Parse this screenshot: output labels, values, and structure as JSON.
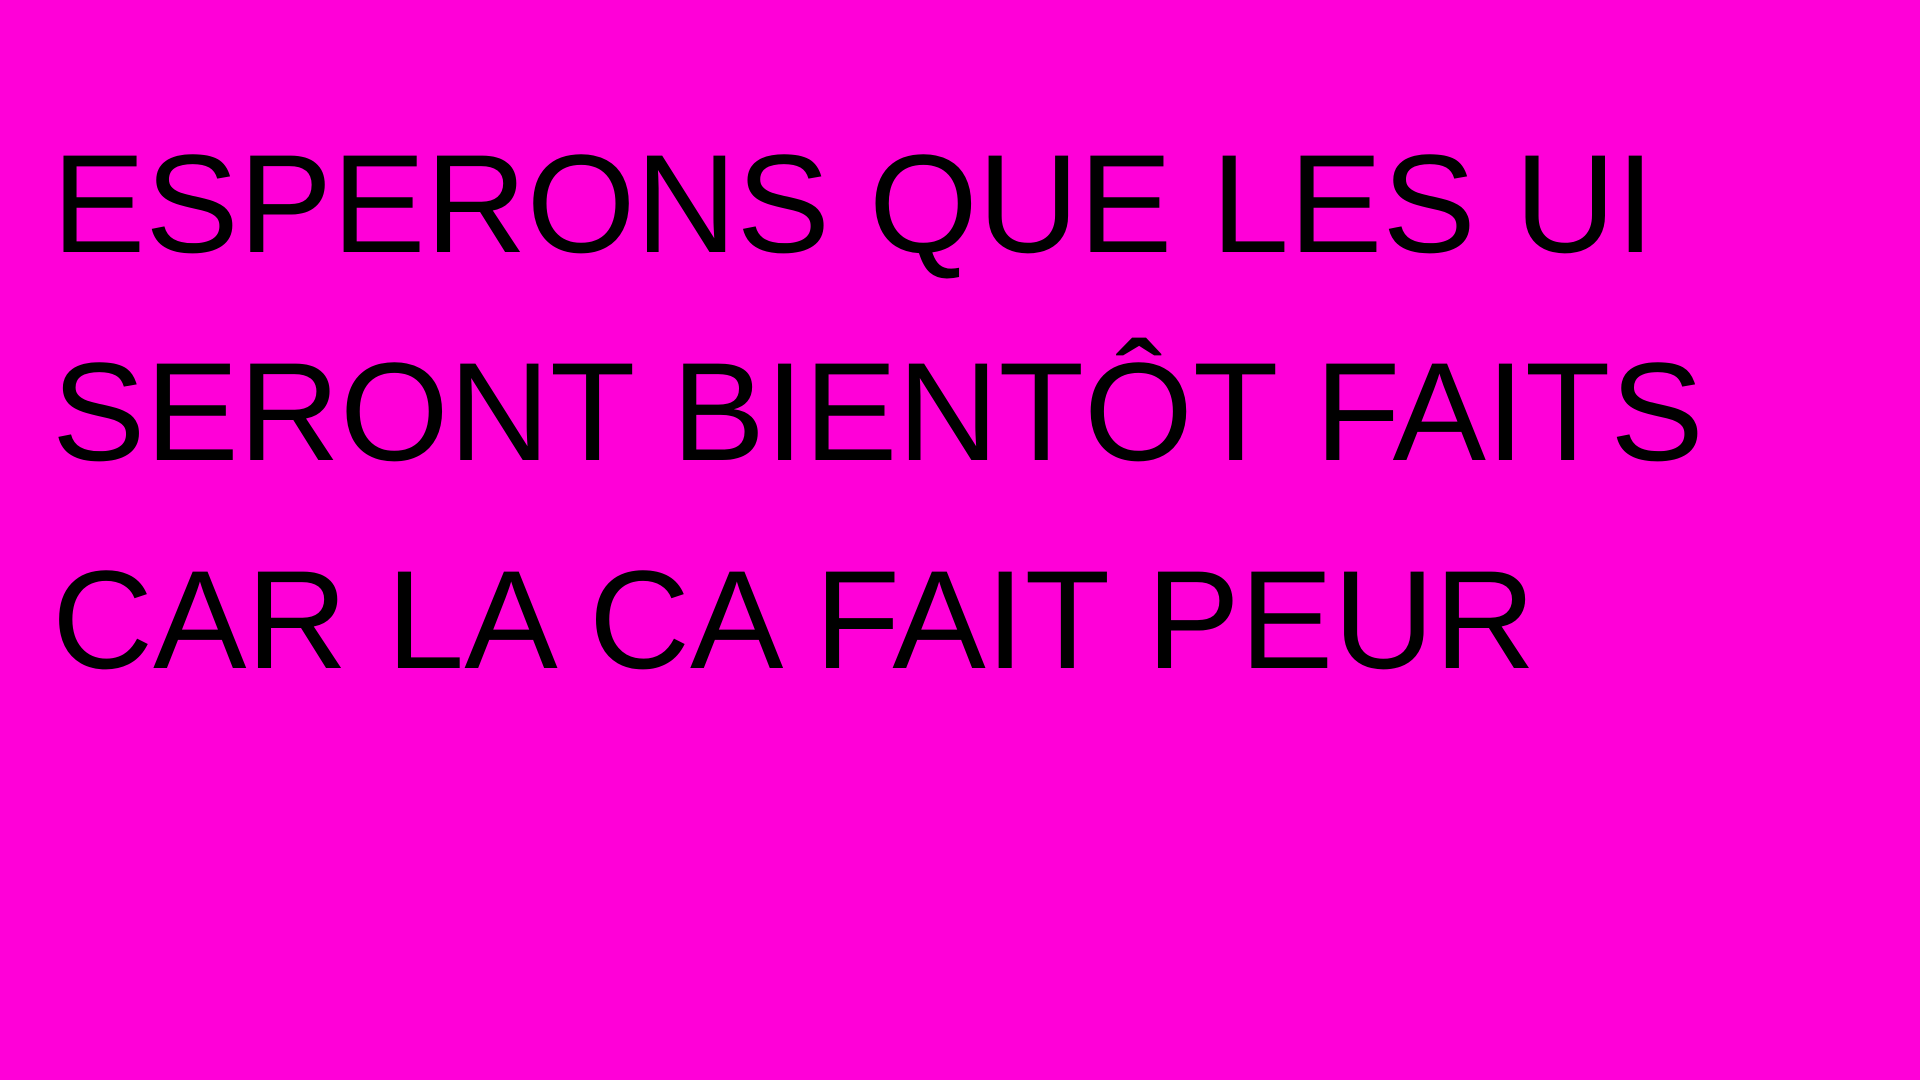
{
  "slide": {
    "background_color": "#ff00d8",
    "text_color": "#000000",
    "lines": [
      "ESPERONS QUE LES UI",
      "SERONT BIENTÔT FAITS",
      "CAR LA CA FAIT PEUR"
    ]
  }
}
